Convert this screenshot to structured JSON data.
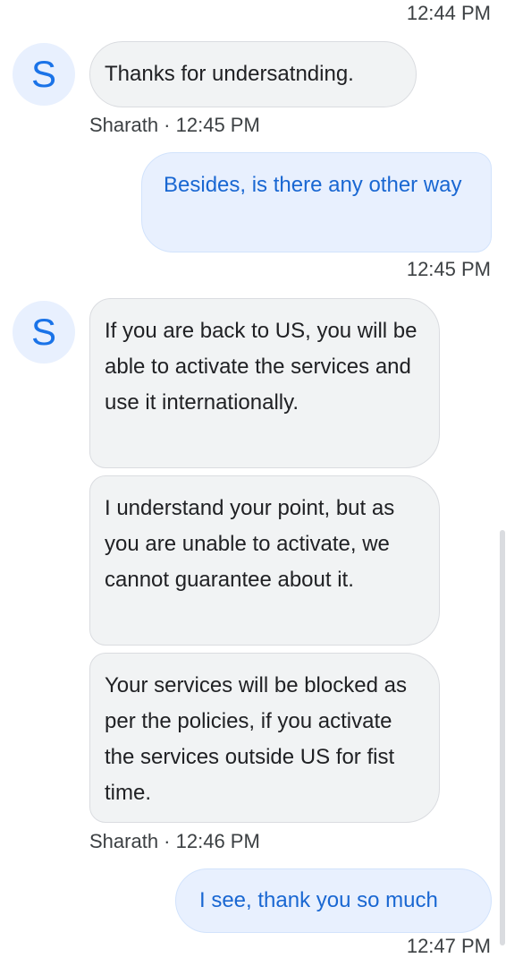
{
  "chat": {
    "messages_top_time": "12:44 PM",
    "avatar_letter": "S",
    "group1": {
      "text": "Thanks for undersatnding.",
      "sender": "Sharath",
      "time": "12:45 PM"
    },
    "out1": {
      "text": "Besides, is there any other way",
      "time": "12:45 PM"
    },
    "group2": {
      "msg1": "If you are back to US, you will be able to activate the services and use it internationally.",
      "msg2": "I understand your point, but as you are unable to activate, we cannot guarantee about it.",
      "msg3": "Your services will be blocked as per the policies, if you activate the services outside US for fist time.",
      "sender": "Sharath",
      "time": "12:46 PM"
    },
    "out2": {
      "text": "I see, thank you so much",
      "time": "12:47 PM"
    }
  },
  "colors": {
    "incoming_bg": "#f1f3f4",
    "outgoing_bg": "#e8f0fe",
    "outgoing_text": "#1967d2",
    "avatar_bg": "#e8f0fe",
    "avatar_text": "#1a73e8"
  }
}
